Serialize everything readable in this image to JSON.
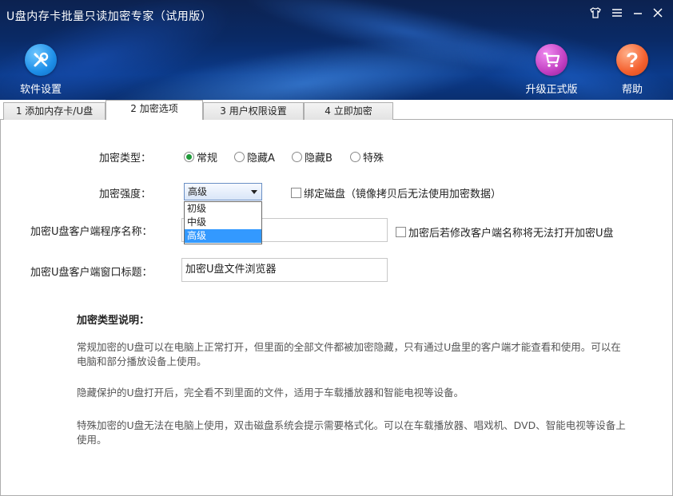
{
  "window": {
    "title": "U盘内存卡批量只读加密专家（试用版）"
  },
  "header": {
    "settings_label": "软件设置",
    "upgrade_label": "升级正式版",
    "help_label": "帮助",
    "help_glyph": "?"
  },
  "tabs": [
    {
      "label": "1 添加内存卡/U盘"
    },
    {
      "label": "2 加密选项"
    },
    {
      "label": "3 用户权限设置"
    },
    {
      "label": "4 立即加密"
    }
  ],
  "form": {
    "encrypt_type_label": "加密类型：",
    "encrypt_types": [
      "常规",
      "隐藏A",
      "隐藏B",
      "特殊"
    ],
    "encrypt_type_selected": "常规",
    "strength_label": "加密强度：",
    "strength_value": "高级",
    "strength_options": [
      "初级",
      "中级",
      "高级"
    ],
    "bind_disk_label": "绑定磁盘（镜像拷贝后无法使用加密数据）",
    "client_name_label": "加密U盘客户端程序名称：",
    "client_name_value": "",
    "rename_lock_label": "加密后若修改客户端名称将无法打开加密U盘",
    "window_title_label": "加密U盘客户端窗口标题：",
    "window_title_value": "加密U盘文件浏览器"
  },
  "description": {
    "title": "加密类型说明：",
    "paragraphs": [
      "常规加密的U盘可以在电脑上正常打开，但里面的全部文件都被加密隐藏，只有通过U盘里的客户端才能查看和使用。可以在电脑和部分播放设备上使用。",
      "隐藏保护的U盘打开后，完全看不到里面的文件，适用于车载播放器和智能电视等设备。",
      "特殊加密的U盘无法在电脑上使用，双击磁盘系统会提示需要格式化。可以在车载播放器、唱戏机、DVD、智能电视等设备上使用。"
    ]
  },
  "colors": {
    "header_bg": "#0b3a8a",
    "radio_checked": "#1f9a3a",
    "selection": "#3399ff"
  }
}
